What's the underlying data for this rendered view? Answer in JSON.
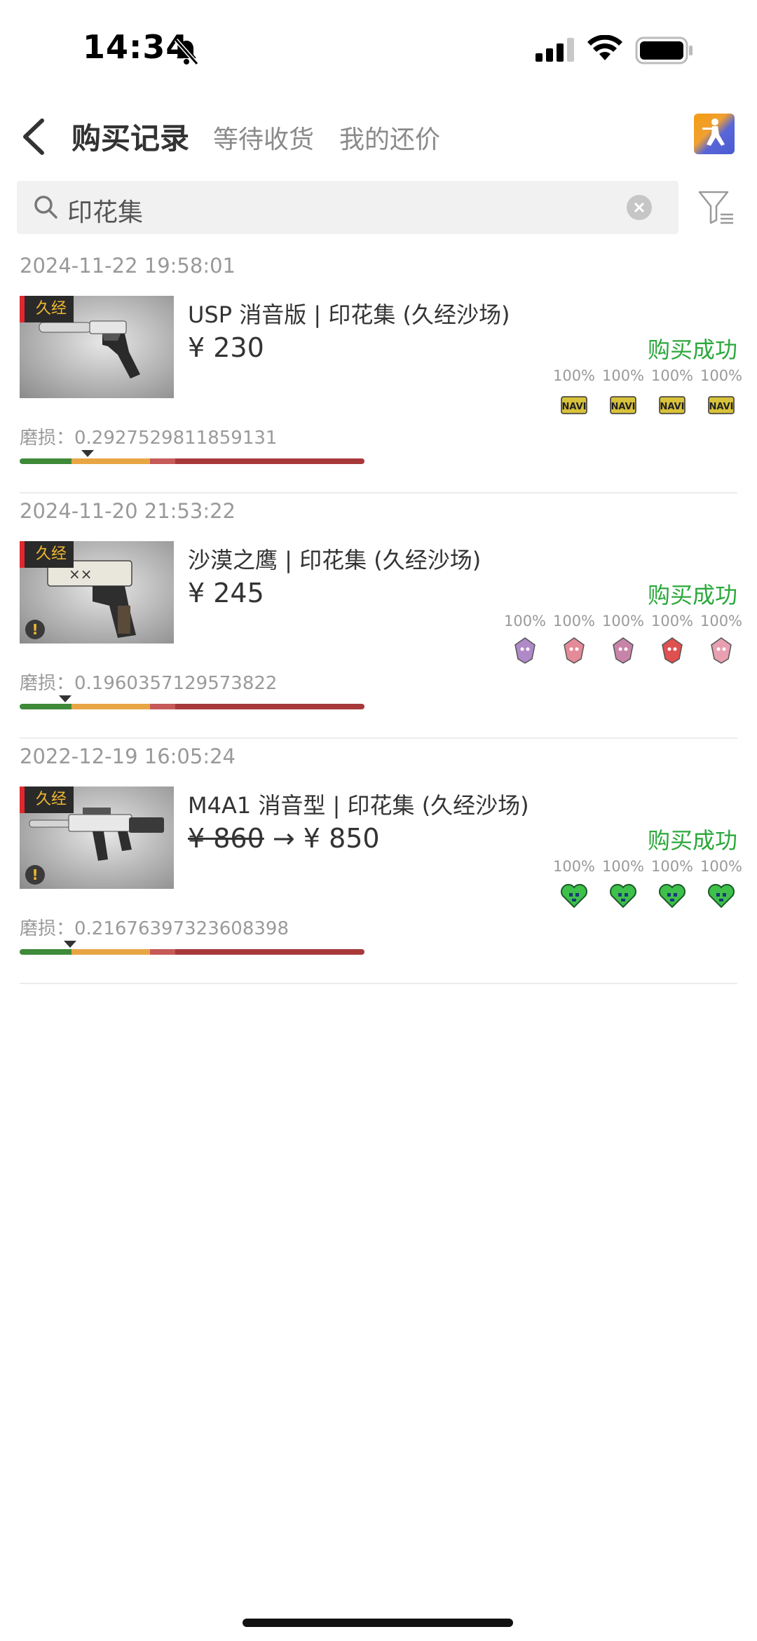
{
  "status_bar": {
    "time": "14:34"
  },
  "header": {
    "tabs": [
      {
        "label": "购买记录",
        "active": true
      },
      {
        "label": "等待收货",
        "active": false
      },
      {
        "label": "我的还价",
        "active": false
      }
    ]
  },
  "search": {
    "value": "印花集"
  },
  "records": [
    {
      "date": "2024-11-22 19:58:01",
      "tag": "久经",
      "name": "USP 消音版 | 印花集 (久经沙场)",
      "price": "¥ 230",
      "status": "购买成功",
      "wear": "磨损：0.2927529811859131",
      "wear_value": 0.2927529811859131,
      "has_warning": false,
      "stickers": [
        {
          "wear": "100%",
          "icon": "navi-sticker-icon",
          "color": "#d8c23a"
        },
        {
          "wear": "100%",
          "icon": "navi-sticker-icon",
          "color": "#d8c23a"
        },
        {
          "wear": "100%",
          "icon": "navi-sticker-icon",
          "color": "#d8c23a"
        },
        {
          "wear": "100%",
          "icon": "navi-sticker-icon",
          "color": "#d8c23a"
        }
      ]
    },
    {
      "date": "2024-11-20 21:53:22",
      "tag": "久经",
      "name": "沙漠之鹰 | 印花集 (久经沙场)",
      "price": "¥ 245",
      "status": "购买成功",
      "wear": "磨损：0.1960357129573822",
      "wear_value": 0.1960357129573822,
      "has_warning": true,
      "stickers": [
        {
          "wear": "100%",
          "icon": "g2-sticker-icon",
          "color": "#b089c8"
        },
        {
          "wear": "100%",
          "icon": "g2-sticker-icon",
          "color": "#e48a98"
        },
        {
          "wear": "100%",
          "icon": "g2-sticker-icon",
          "color": "#c884a8"
        },
        {
          "wear": "100%",
          "icon": "g2-sticker-icon",
          "color": "#e05050"
        },
        {
          "wear": "100%",
          "icon": "g2-sticker-icon",
          "color": "#e8a0b0"
        }
      ]
    },
    {
      "date": "2022-12-19 16:05:24",
      "tag": "久经",
      "name": "M4A1 消音型 | 印花集 (久经沙场)",
      "old_price": "¥ 860",
      "price": "→ ¥ 850",
      "status": "购买成功",
      "wear": "磨损：0.21676397323608398",
      "wear_value": 0.21676397323608398,
      "has_warning": true,
      "stickers": [
        {
          "wear": "100%",
          "icon": "heart-sticker-icon",
          "color": "#3ec04a"
        },
        {
          "wear": "100%",
          "icon": "heart-sticker-icon",
          "color": "#3ec04a"
        },
        {
          "wear": "100%",
          "icon": "heart-sticker-icon",
          "color": "#3ec04a"
        },
        {
          "wear": "100%",
          "icon": "heart-sticker-icon",
          "color": "#3ec04a"
        }
      ]
    }
  ],
  "colors": {
    "success": "#2ca83c",
    "tag_bg": "#2a2a2a",
    "tag_text": "#f0b830"
  }
}
